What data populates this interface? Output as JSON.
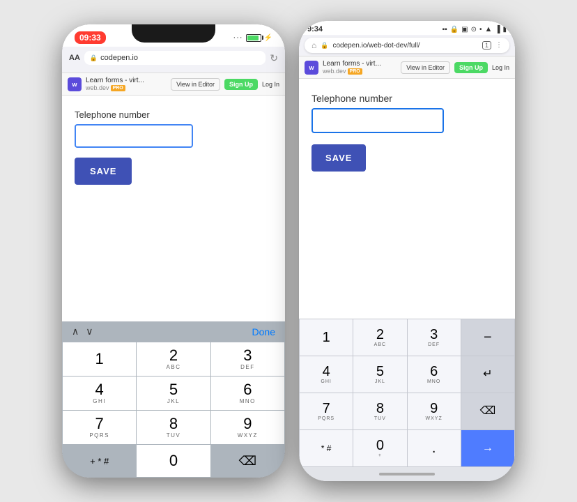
{
  "left_phone": {
    "status_time": "09:33",
    "url": "codepen.io",
    "toolbar_title": "Learn forms - virt...",
    "toolbar_domain": "web.dev",
    "pro_badge": "PRO",
    "btn_view_editor": "View in Editor",
    "btn_signup": "Sign Up",
    "btn_login": "Log In",
    "field_label": "Telephone number",
    "save_btn": "SAVE",
    "keyboard_done": "Done",
    "keys": [
      {
        "main": "1",
        "sub": ""
      },
      {
        "main": "2",
        "sub": "ABC"
      },
      {
        "main": "3",
        "sub": "DEF"
      },
      {
        "main": "4",
        "sub": "GHI"
      },
      {
        "main": "5",
        "sub": "JKL"
      },
      {
        "main": "6",
        "sub": "MNO"
      },
      {
        "main": "7",
        "sub": "PQRS"
      },
      {
        "main": "8",
        "sub": "TUV"
      },
      {
        "main": "9",
        "sub": "WXYZ"
      },
      {
        "main": "+ * #",
        "sub": ""
      },
      {
        "main": "0",
        "sub": ""
      },
      {
        "main": "⌫",
        "sub": ""
      }
    ]
  },
  "right_phone": {
    "status_time": "9:34",
    "url": "codepen.io/web-dot-dev/full/",
    "toolbar_title": "Learn forms - virt...",
    "toolbar_domain": "web.dev",
    "pro_badge": "PRO",
    "btn_view_editor": "View in Editor",
    "btn_signup": "Sign Up",
    "btn_login": "Log In",
    "field_label": "Telephone number",
    "save_btn": "SAVE",
    "keys": [
      {
        "main": "1",
        "sub": "",
        "type": "light"
      },
      {
        "main": "2",
        "sub": "ABC",
        "type": "light"
      },
      {
        "main": "3",
        "sub": "DEF",
        "type": "light"
      },
      {
        "main": "−",
        "sub": "",
        "type": "dark"
      },
      {
        "main": "4",
        "sub": "GHI",
        "type": "light"
      },
      {
        "main": "5",
        "sub": "JKL",
        "type": "light"
      },
      {
        "main": "6",
        "sub": "MNO",
        "type": "light"
      },
      {
        "main": "↵",
        "sub": "",
        "type": "dark"
      },
      {
        "main": "7",
        "sub": "PQRS",
        "type": "light"
      },
      {
        "main": "8",
        "sub": "TUV",
        "type": "light"
      },
      {
        "main": "9",
        "sub": "WXYZ",
        "type": "light"
      },
      {
        "main": "⌫",
        "sub": "",
        "type": "dark"
      },
      {
        "main": "* #",
        "sub": "",
        "type": "light"
      },
      {
        "main": "0",
        "sub": "+",
        "type": "light"
      },
      {
        "main": ".",
        "sub": "",
        "type": "light"
      },
      {
        "main": "→",
        "sub": "",
        "type": "action"
      }
    ]
  }
}
